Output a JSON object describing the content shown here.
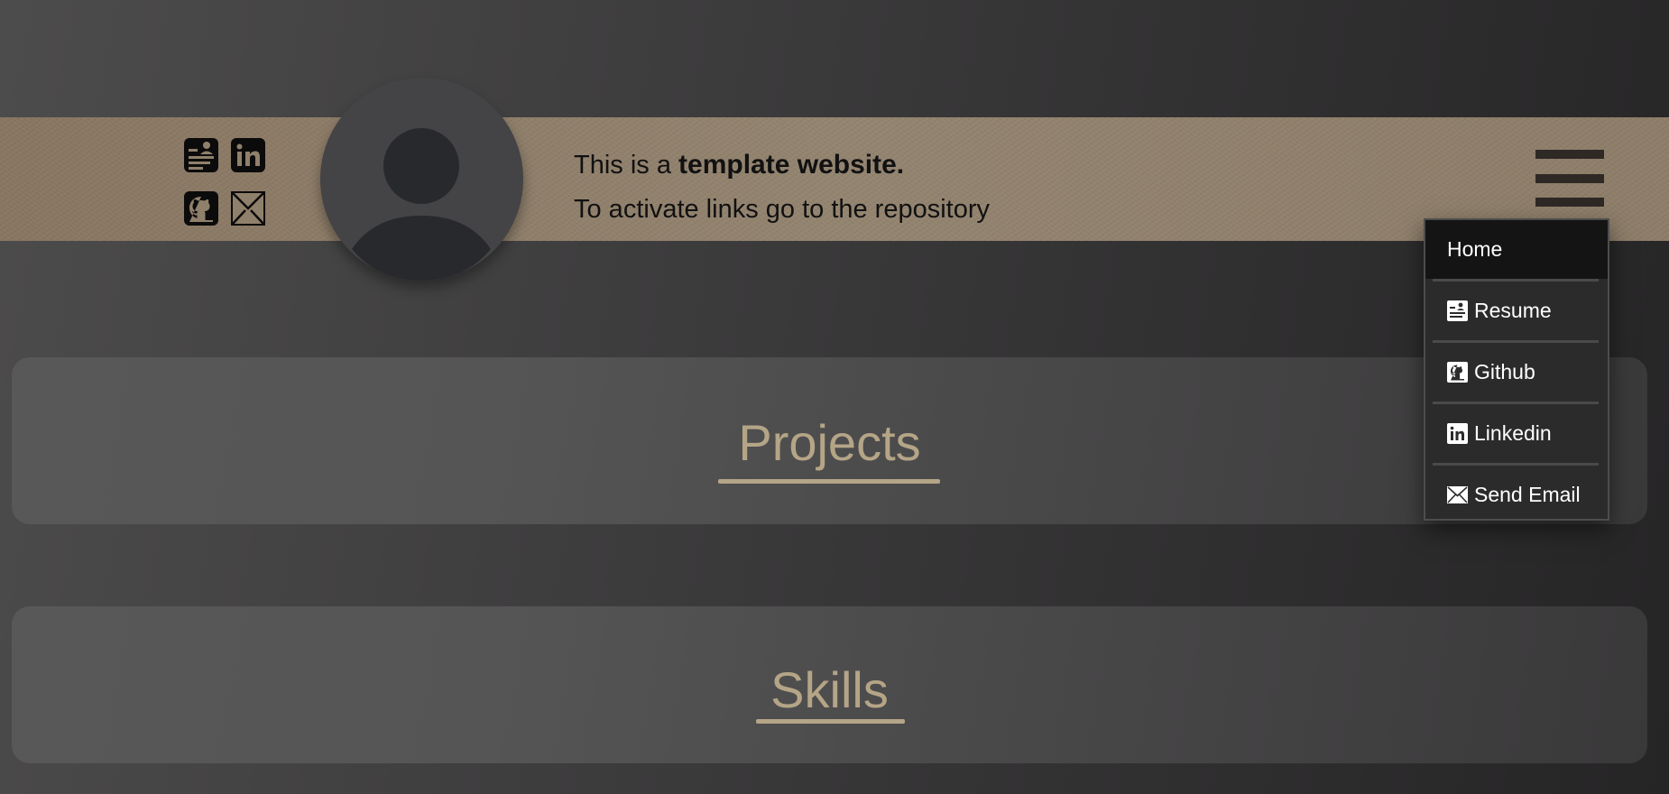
{
  "header": {
    "intro_prefix": "This is a ",
    "intro_bold": "template website.",
    "intro_line2": "To activate links go to the repository",
    "social_icons": [
      "resume-icon",
      "linkedin-icon",
      "github-icon",
      "email-icon"
    ]
  },
  "nav": {
    "items": [
      {
        "label": "Home",
        "icon": null
      },
      {
        "label": "Resume",
        "icon": "resume-icon"
      },
      {
        "label": "Github",
        "icon": "github-icon"
      },
      {
        "label": "Linkedin",
        "icon": "linkedin-icon"
      },
      {
        "label": "Send Email",
        "icon": "email-icon"
      }
    ]
  },
  "sections": {
    "projects_title": "Projects",
    "skills_title": "Skills"
  },
  "colors": {
    "accent": "#b5a587",
    "header_band": "#8a7a66",
    "background_dark": "#262526",
    "menu_bg": "#2c2b2c",
    "menu_active": "#151415"
  }
}
